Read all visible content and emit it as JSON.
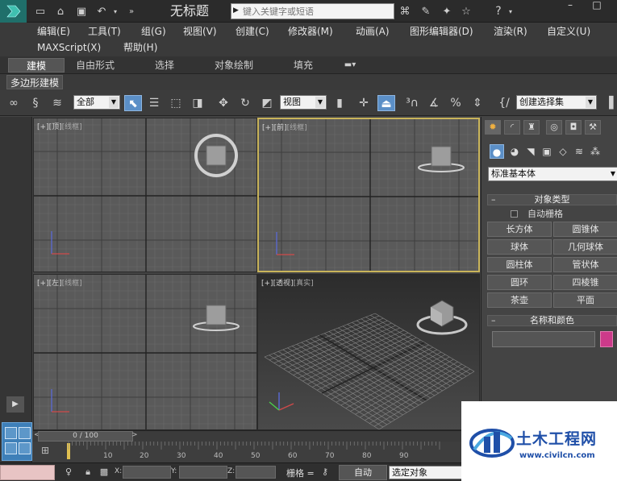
{
  "titlebar": {
    "doc_title": "无标题",
    "search_placeholder": "键入关键字或短语"
  },
  "menus": {
    "row1": [
      "编辑(E)",
      "工具(T)",
      "组(G)",
      "视图(V)",
      "创建(C)",
      "修改器(M)",
      "动画(A)",
      "图形编辑器(D)",
      "渲染(R)",
      "自定义(U)"
    ],
    "row2": [
      "MAXScript(X)",
      "帮助(H)"
    ]
  },
  "ribbon": {
    "tabs": [
      "建模",
      "自由形式",
      "选择",
      "对象绘制",
      "填充"
    ],
    "active_tab": "建模",
    "subtab": "多边形建模"
  },
  "toolbar": {
    "filter_value": "全部",
    "ref_coord_value": "视图",
    "named_selection_value": "创建选择集"
  },
  "viewports": [
    {
      "id": "top",
      "label_main": "[+][顶]",
      "label_dim": "[线框]"
    },
    {
      "id": "front",
      "label_main": "[+][前]",
      "label_dim": "[线框]"
    },
    {
      "id": "left",
      "label_main": "[+][左]",
      "label_dim": "[线框]"
    },
    {
      "id": "perspective",
      "label_main": "[+][透视]",
      "label_dim": "[真实]"
    }
  ],
  "command_panel": {
    "primitive_type": "标准基本体",
    "object_type_title": "对象类型",
    "autogrid_label": "自动栅格",
    "buttons": [
      "长方体",
      "圆锥体",
      "球体",
      "几何球体",
      "圆柱体",
      "管状体",
      "圆环",
      "四棱锥",
      "茶壶",
      "平面"
    ],
    "name_color_title": "名称和颜色",
    "color_swatch": "#cc3a8a"
  },
  "timeline": {
    "slider_text": "0 / 100",
    "ticks": [
      "10",
      "20",
      "30",
      "40",
      "50",
      "60",
      "70",
      "80",
      "90"
    ]
  },
  "statusbar": {
    "x_label": "X:",
    "y_label": "Y:",
    "z_label": "Z:",
    "grid_label": "栅格 =",
    "auto_button": "自动",
    "selection_set_value": "选定对象"
  },
  "watermark": {
    "title": "土木工程网",
    "url": "www.civilcn.com"
  },
  "colors": {
    "active_viewport_border": "#c9b45a",
    "accent_blue": "#5b8fc7",
    "watermark_blue": "#1f4fa8"
  }
}
